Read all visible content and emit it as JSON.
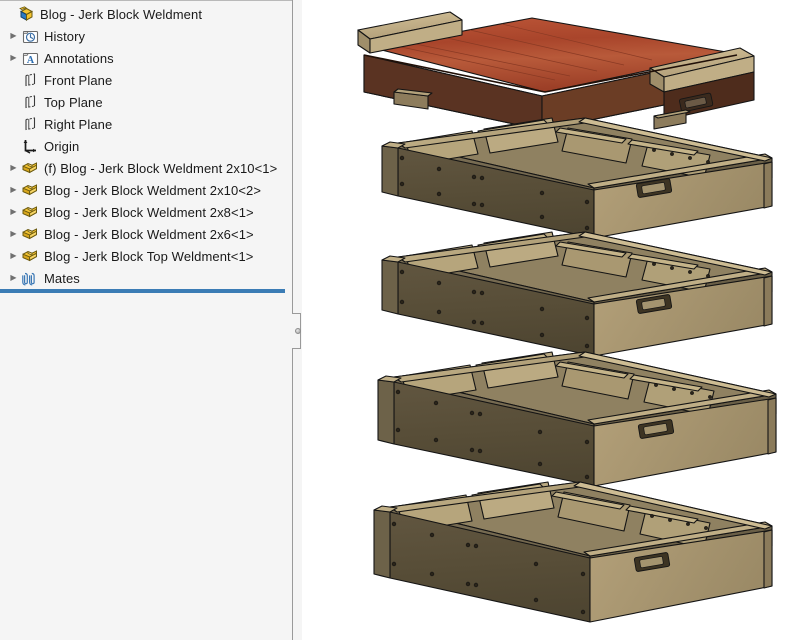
{
  "app": {
    "type": "cad-assembly-feature-tree",
    "panel_background": "#f5f5f5",
    "graphics_background": "#ffffff",
    "accent_rule_color": "#3b7cb5"
  },
  "tree": {
    "root": {
      "label": "Blog - Jerk Block Weldment",
      "icon": "assembly-icon",
      "expanded": true
    },
    "items": [
      {
        "label": "History",
        "icon": "history-folder-icon",
        "arrow": true,
        "indent": 1
      },
      {
        "label": "Annotations",
        "icon": "annotations-folder-icon",
        "arrow": true,
        "indent": 1
      },
      {
        "label": "Front Plane",
        "icon": "plane-icon",
        "arrow": false,
        "indent": 1
      },
      {
        "label": "Top Plane",
        "icon": "plane-icon",
        "arrow": false,
        "indent": 1
      },
      {
        "label": "Right Plane",
        "icon": "plane-icon",
        "arrow": false,
        "indent": 1
      },
      {
        "label": "Origin",
        "icon": "origin-icon",
        "arrow": false,
        "indent": 1
      },
      {
        "label": "(f) Blog - Jerk Block Weldment 2x10<1>",
        "icon": "part-icon",
        "arrow": true,
        "indent": 1
      },
      {
        "label": "Blog - Jerk Block Weldment 2x10<2>",
        "icon": "part-icon",
        "arrow": true,
        "indent": 1
      },
      {
        "label": "Blog - Jerk Block Weldment 2x8<1>",
        "icon": "part-icon",
        "arrow": true,
        "indent": 1
      },
      {
        "label": "Blog - Jerk Block Weldment 2x6<1>",
        "icon": "part-icon",
        "arrow": true,
        "indent": 1
      },
      {
        "label": "Blog - Jerk Block Top Weldment<1>",
        "icon": "part-icon",
        "arrow": true,
        "indent": 1
      },
      {
        "label": "Mates",
        "icon": "mates-paperclip-icon",
        "arrow": true,
        "indent": 1
      }
    ]
  },
  "graphics": {
    "view_description": "Exploded isometric view of a stacked jerk block weldment assembly",
    "model_colors": {
      "box_front_face": "#5a5038",
      "box_end_face": "#a9976f",
      "box_rail_light": "#bbaa82",
      "box_interior": "#6e6348",
      "top_platform_red": "#b04a2e",
      "top_platform_dark": "#5a3322",
      "top_cleat_tan": "#c3b189",
      "outline": "#1a1a1a"
    },
    "components": [
      {
        "name": "Blog - Jerk Block Top Weldment<1>",
        "position": "top",
        "color": "#b04a2e"
      },
      {
        "name": "Blog - Jerk Block Weldment 2x6<1>",
        "position": "second",
        "color": "#5a5038"
      },
      {
        "name": "Blog - Jerk Block Weldment 2x8<1>",
        "position": "third",
        "color": "#5a5038"
      },
      {
        "name": "Blog - Jerk Block Weldment 2x10<2>",
        "position": "fourth",
        "color": "#5a5038"
      },
      {
        "name": "(f) Blog - Jerk Block Weldment 2x10<1>",
        "position": "bottom",
        "color": "#5a5038"
      }
    ]
  },
  "splitter": {
    "label": "panel-splitter",
    "grip": "splitter-grip-handle"
  }
}
